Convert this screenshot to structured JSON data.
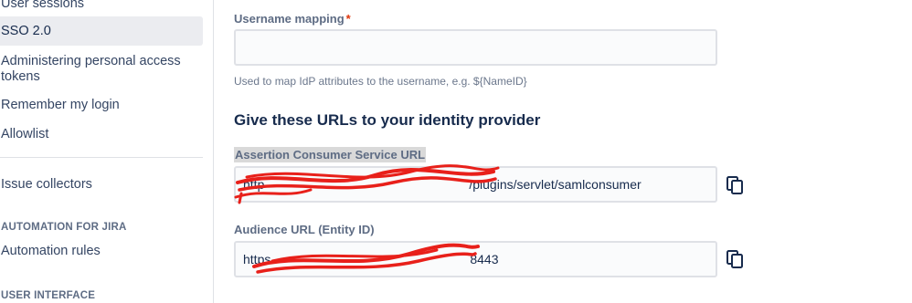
{
  "sidebar": {
    "items": [
      {
        "label": "User sessions"
      },
      {
        "label": "SSO 2.0"
      },
      {
        "label": "Administering personal access tokens"
      },
      {
        "label": "Remember my login"
      },
      {
        "label": "Allowlist"
      },
      {
        "label": "Issue collectors"
      },
      {
        "label": "Automation rules"
      }
    ],
    "sections": [
      "AUTOMATION FOR JIRA",
      "USER INTERFACE"
    ]
  },
  "form": {
    "username_mapping": {
      "label": "Username mapping",
      "required_mark": "*",
      "value": "",
      "help": "Used to map IdP attributes to the username, e.g. ${NameID}"
    },
    "section_heading": "Give these URLs to your identity provider",
    "acs_url": {
      "label": "Assertion Consumer Service URL",
      "value_prefix": "http",
      "value_visible": "/plugins/servlet/samlconsumer"
    },
    "audience_url": {
      "label": "Audience URL (Entity ID)",
      "value_prefix": "https",
      "value_visible": "8443"
    }
  },
  "icons": {
    "copy": "copy-icon"
  },
  "colors": {
    "required": "#de350b",
    "redaction": "#e8201a",
    "active_nav_bg": "#ebecf0"
  }
}
